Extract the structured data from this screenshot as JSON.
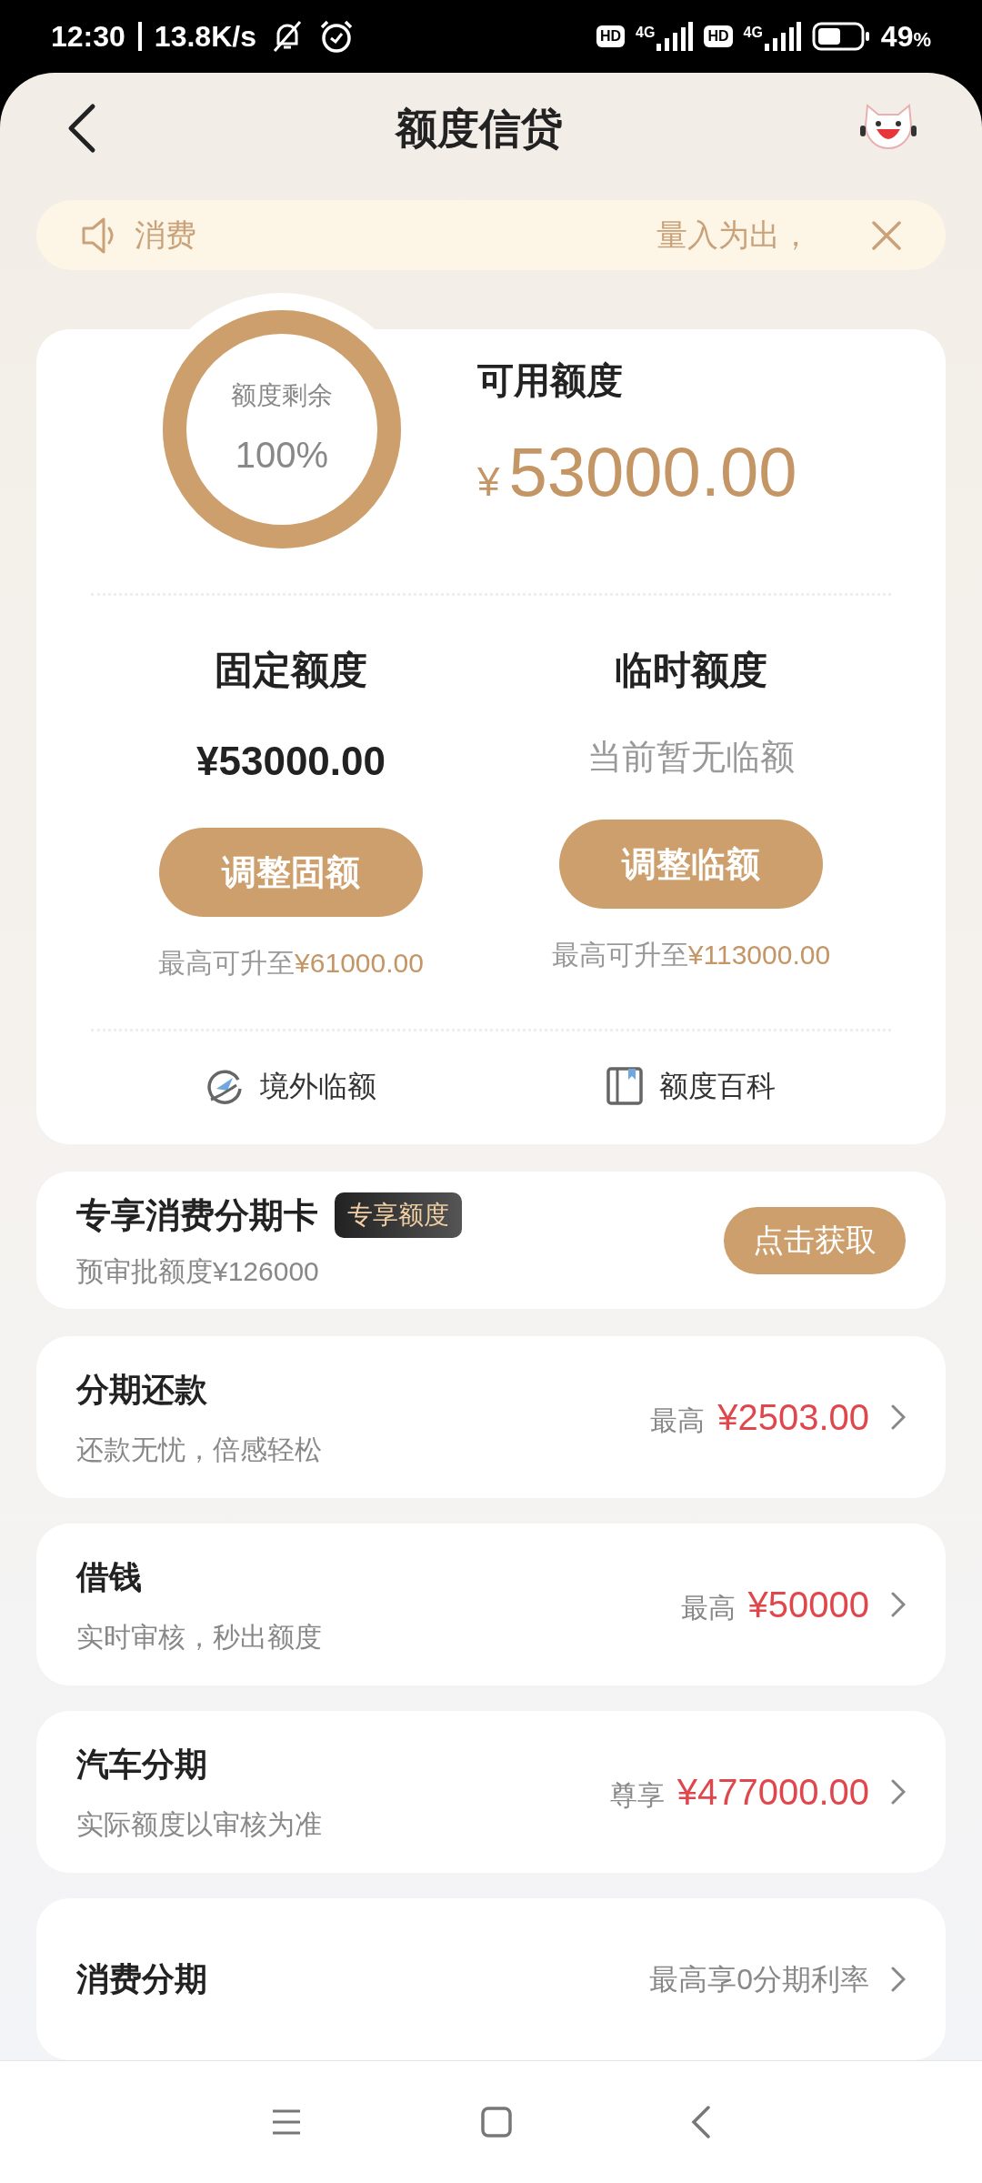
{
  "status_bar": {
    "time": "12:30",
    "speed": "13.8K/s",
    "sims": [
      {
        "badge": "HD",
        "network": "4G"
      },
      {
        "badge": "HD",
        "network": "4G"
      }
    ],
    "battery": "49",
    "battery_unit": "%"
  },
  "header": {
    "title": "额度信贷"
  },
  "notice": {
    "left_text": "消费",
    "right_text": "量入为出，"
  },
  "quota": {
    "ring_label": "额度剩余",
    "ring_value": "100%",
    "level": 1,
    "available_label": "可用额度",
    "currency": "¥",
    "available_amount": "53000.00",
    "columns": [
      {
        "title": "固定额度",
        "value": "¥53000.00",
        "muted": false,
        "button": "调整固额",
        "max_prefix": "最高可升至",
        "max_amount": "¥61000.00"
      },
      {
        "title": "临时额度",
        "value": "当前暂无临额",
        "muted": true,
        "button": "调整临额",
        "max_prefix": "最高可升至",
        "max_amount": "¥113000.00"
      }
    ],
    "links": [
      {
        "kind": "overseas",
        "label": "境外临额"
      },
      {
        "kind": "book",
        "label": "额度百科"
      }
    ]
  },
  "card_offer": {
    "title": "专享消费分期卡",
    "tag": "专享额度",
    "subtitle": "预审批额度¥126000",
    "button": "点击获取"
  },
  "products": [
    {
      "kind": "amount",
      "title": "分期还款",
      "subtitle": "还款无忧，倍感轻松",
      "prefix": "最高",
      "amount": "¥2503.00"
    },
    {
      "kind": "amount",
      "title": "借钱",
      "subtitle": "实时审核，秒出额度",
      "prefix": "最高",
      "amount": "¥50000"
    },
    {
      "kind": "amount",
      "title": "汽车分期",
      "subtitle": "实际额度以审核为准",
      "prefix": "尊享",
      "amount": "¥477000.00"
    },
    {
      "kind": "note",
      "title": "消费分期",
      "note": "最高享0分期利率"
    }
  ]
}
